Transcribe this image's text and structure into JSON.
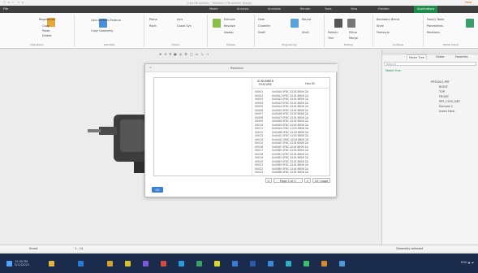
{
  "app": {
    "title": "Creo Parametric - Relation / Parameter Dialog",
    "user_badge": "Help",
    "quick_access": [
      "□",
      "▸",
      "←",
      "→",
      "⌂"
    ]
  },
  "ribbon_tabs": {
    "left_label": "File",
    "items": [
      "Model",
      "Analysis",
      "Annotate",
      "Render",
      "Tools",
      "View",
      "Flexible",
      "Applications"
    ],
    "active_index": 7
  },
  "ribbon_groups": [
    {
      "label": "Operations",
      "items": [
        "Regenerate",
        "Copy",
        "Paste",
        "Delete"
      ]
    },
    {
      "label": "Get Data",
      "items": [
        "User-Defined Feature",
        "Copy Geometry"
      ]
    },
    {
      "label": "Datum",
      "items": [
        "Plane",
        "Axis",
        "Point",
        "Coord Sys"
      ]
    },
    {
      "label": "Shapes",
      "items": [
        "Extrude",
        "Revolve",
        "Sweep"
      ]
    },
    {
      "label": "Engineering",
      "items": [
        "Hole",
        "Round",
        "Chamfer",
        "Draft",
        "Shell"
      ]
    },
    {
      "label": "Editing",
      "items": [
        "Pattern",
        "Mirror",
        "Trim",
        "Merge"
      ]
    },
    {
      "label": "Surfaces",
      "items": [
        "Boundary Blend",
        "Style",
        "Freestyle"
      ]
    },
    {
      "label": "Model Intent",
      "items": [
        "Family Table",
        "Parameters",
        "Relations"
      ]
    }
  ],
  "view_toolbar": [
    "⊕",
    "⊖",
    "⌗",
    "▣",
    "◎",
    "⚙",
    "▢",
    "▭",
    "↘",
    "→"
  ],
  "right_pane": {
    "tabs": [
      "Model Tree",
      "Folder",
      "Favorites"
    ],
    "filter_placeholder": "Search",
    "rows": [
      "Model Tree",
      "PRT0001.PRT",
      "RIGHT",
      "TOP",
      "FRONT",
      "PRT_CSYS_DEF",
      "Extrude 1",
      "Insert Here"
    ]
  },
  "dialog": {
    "title": "Relations",
    "close_icon": "×",
    "col_a_header": "ID NUMBER",
    "col_a_sub": "FEATURE",
    "col_b_header": "Hex ID",
    "rows": [
      {
        "id": "00001",
        "hex": "0x00A0 0F8C 4218 8B06 2A"
      },
      {
        "id": "00002",
        "hex": "0x00A1 0F8C 4218 8B06 2A"
      },
      {
        "id": "00003",
        "hex": "0x00A2 0F8C 4218 8B06 2A"
      },
      {
        "id": "00004",
        "hex": "0x00A3 0F8C 4218 8B06 2A"
      },
      {
        "id": "00005",
        "hex": "0x00A4 0F8C 4218 8B06 2A"
      },
      {
        "id": "00006",
        "hex": "0x00A5 0F8C 4218 8B06 2A"
      },
      {
        "id": "00007",
        "hex": "0x00A6 0F8C 4218 8B06 2A"
      },
      {
        "id": "00008",
        "hex": "0x00A7 0F8C 4218 8B06 2A"
      },
      {
        "id": "00009",
        "hex": "0x00A8 0F8C 4218 8B06 2A"
      },
      {
        "id": "00010",
        "hex": "0x00A9 0F8C 4218 8B06 2A"
      },
      {
        "id": "00011",
        "hex": "0x00AA 0F8C 4218 8B06 2A"
      },
      {
        "id": "00012",
        "hex": "0x00AB 0F8C 4218 8B06 2A"
      },
      {
        "id": "00013",
        "hex": "0x00AC 0F8C 4218 8B06 2A"
      },
      {
        "id": "00014",
        "hex": "0x00AD 0F8C 4218 8B06 2A"
      },
      {
        "id": "00015",
        "hex": "0x00AE 0F8C 4218 8B06 2A"
      },
      {
        "id": "00016",
        "hex": "0x00AF 0F8C 4218 8B06 2A"
      },
      {
        "id": "00017",
        "hex": "0x00B0 0F8C 4218 8B06 2A"
      },
      {
        "id": "00018",
        "hex": "0x00B1 0F8C 4218 8B06 2A"
      },
      {
        "id": "00019",
        "hex": "0x00B2 0F8C 4218 8B06 2A"
      },
      {
        "id": "00020",
        "hex": "0x00B3 0F8C 4218 8B06 2A"
      },
      {
        "id": "00021",
        "hex": "0x00B4 0F8C 4218 8B06 2A"
      },
      {
        "id": "00022",
        "hex": "0x00B5 0F8C 4218 8B06 2A"
      },
      {
        "id": "00023",
        "hex": "0x00B6 0F8C 4218 8B06 2A"
      }
    ],
    "pager_prev": "<",
    "pager_label": "Page 1 of 1",
    "pager_next": ">",
    "pager_size": "10 / page",
    "ok_label": "OK"
  },
  "status_bar": {
    "left_label": "Smart",
    "page": "1 - 14",
    "right_text": "Geometry selected"
  },
  "taskbar": {
    "clock": "12:30 PM",
    "date": "5/12/2023",
    "tray_text": "ENG  ▲  ☁"
  },
  "colors": {
    "accent": "#1e8a4b",
    "dialog_ok": "#3b7fd4",
    "taskbar_bg": "#1b2b4b"
  }
}
